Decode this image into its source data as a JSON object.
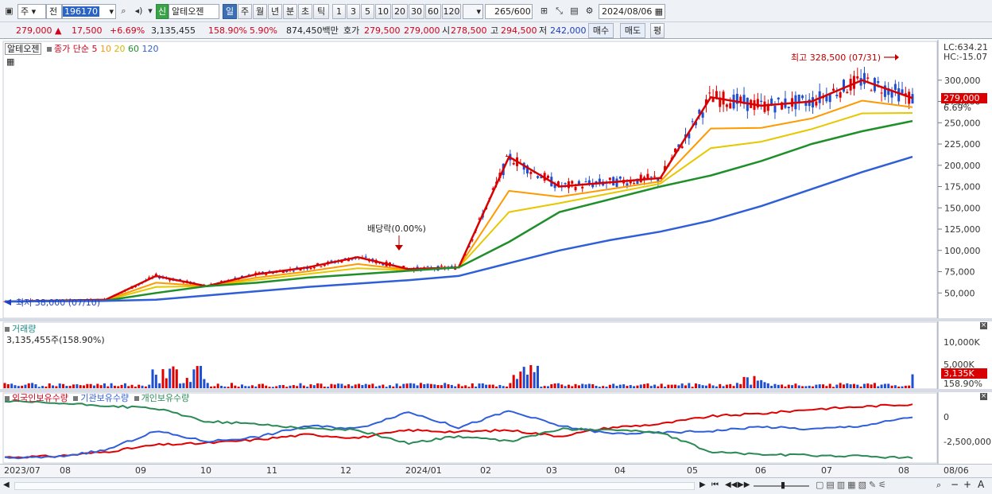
{
  "toolbar": {
    "market": "주",
    "type": "전",
    "code": "196170",
    "tag": "신",
    "name": "알테오젠",
    "periods": [
      "일",
      "주",
      "월",
      "년",
      "분",
      "초",
      "틱"
    ],
    "active_period": "일",
    "intervals": [
      "1",
      "3",
      "5",
      "10",
      "20",
      "30",
      "60",
      "120"
    ],
    "count": "265",
    "count_max": "/600",
    "date": "2024/08/06"
  },
  "quote": {
    "price": "279,000",
    "change": "17,500",
    "change_pct": "+6.69%",
    "volume": "3,135,455",
    "volume_ratio": "158.90%",
    "turnover": "5.90%",
    "amount": "874,450백만",
    "bid_label": "호가",
    "bid": "279,500",
    "ask": "279,000",
    "open_label": "시",
    "open": "278,500",
    "high_label": "고",
    "high": "294,500",
    "low_label": "저",
    "low": "242,000",
    "buy_button": "매수",
    "sell_button": "매도",
    "eval_button": "평"
  },
  "price_panel": {
    "legend_name": "알테오젠",
    "legend_label": "종가 단순",
    "ma": [
      "5",
      "10",
      "20",
      "60",
      "120"
    ],
    "ma_colors": [
      "#d80000",
      "#ff9900",
      "#e6c800",
      "#1f8f2a",
      "#2f5fd8"
    ],
    "lc": "LC:634.21",
    "hc": "HC:-15.07",
    "last_price": "279,000",
    "last_pct": "6.69%",
    "high_note": "최고 328,500 (07/31)",
    "low_note": "최저 38,000 (07/10)",
    "dividend_note": "배당락(0.00%)"
  },
  "volume_panel": {
    "title": "거래량",
    "value": "3,135,455주(158.90%)",
    "last_value": "3,135K",
    "last_pct": "158.90%",
    "axis": [
      "10,000K",
      "5,000K"
    ]
  },
  "holding_panel": {
    "series_names": [
      "외국인보유수량",
      "기관보유수량",
      "개인보유수량"
    ],
    "axis": [
      "0",
      "-2,500,000"
    ]
  },
  "x_labels": [
    "2023/07",
    "08",
    "09",
    "10",
    "11",
    "12",
    "2024/01",
    "02",
    "03",
    "04",
    "05",
    "06",
    "07",
    "08"
  ],
  "x_right_label": "08/06",
  "chart_data": [
    {
      "type": "line",
      "title": "알테오젠",
      "x": [
        "2023/07",
        "08",
        "09",
        "10",
        "11",
        "12",
        "2024/01",
        "02",
        "03",
        "04",
        "05",
        "06",
        "07",
        "08"
      ],
      "ylim": [
        25000,
        340000
      ],
      "y_ticks": [
        "300,000",
        "275,000",
        "250,000",
        "225,000",
        "200,000",
        "175,000",
        "150,000",
        "125,000",
        "100,000",
        "75,000",
        "50,000"
      ],
      "series": [
        {
          "name": "5",
          "values": [
            40000,
            41000,
            42000,
            70000,
            58000,
            72000,
            80000,
            92000,
            78000,
            80000,
            210000,
            175000,
            180000,
            185000,
            280000,
            270000,
            275000,
            300000,
            279000
          ]
        },
        {
          "name": "60",
          "values": [
            40000,
            40500,
            41000,
            50000,
            58000,
            62000,
            68000,
            72000,
            76000,
            80000,
            110000,
            145000,
            160000,
            175000,
            188000,
            205000,
            225000,
            240000,
            252000
          ]
        },
        {
          "name": "120",
          "values": [
            40000,
            40300,
            40600,
            42000,
            47000,
            52000,
            57000,
            61000,
            65000,
            70000,
            85000,
            100000,
            112000,
            122000,
            135000,
            152000,
            172000,
            192000,
            210000
          ]
        }
      ]
    },
    {
      "type": "bar",
      "title": "거래량",
      "ylim": [
        0,
        14000000
      ],
      "y_ticks": [
        "10,000K",
        "5,000K"
      ],
      "values": [
        3135455
      ]
    },
    {
      "type": "line",
      "title": "외국인보유수량",
      "ylim": [
        -5000000,
        2500000
      ],
      "y_ticks": [
        "0",
        "-2,500,000"
      ],
      "series": [
        {
          "name": "외국인보유수량",
          "values": [
            -4600000,
            -4500000,
            -4000000,
            -3200000,
            -3000000,
            -2600000,
            -2000000,
            -2400000,
            -1500000,
            -1700000,
            -1500000,
            -2200000,
            -1200000,
            -800000,
            100000,
            400000,
            900000,
            1200000,
            1500000
          ]
        },
        {
          "name": "기관보유수량",
          "values": [
            -4700000,
            -4600000,
            -3800000,
            -1600000,
            -2800000,
            -2300000,
            -1000000,
            -1300000,
            600000,
            -1200000,
            700000,
            -1000000,
            -1900000,
            -1800000,
            -1600000,
            -1100000,
            -1400000,
            -1000000,
            0
          ]
        },
        {
          "name": "개인보유수량",
          "values": [
            1800000,
            1600000,
            1300000,
            1000000,
            -500000,
            -800000,
            -1300000,
            -1500000,
            -3000000,
            -2200000,
            -2800000,
            -1400000,
            -1400000,
            -1800000,
            -4000000,
            -4300000,
            -4400000,
            -4500000,
            -4700000
          ]
        }
      ]
    }
  ]
}
